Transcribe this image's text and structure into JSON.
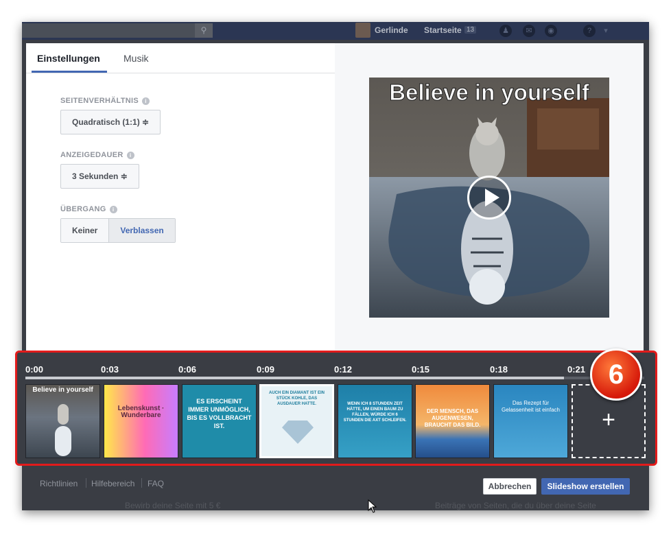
{
  "topbar": {
    "user_name": "Gerlinde",
    "home_label": "Startseite",
    "home_count": "13"
  },
  "background": {
    "snippet_left": "Bewirb deine Seite mit 5 €",
    "snippet_right": "Beiträge von Seiten, die du über deine Seite"
  },
  "tabs": [
    {
      "label": "Einstellungen",
      "active": true
    },
    {
      "label": "Musik",
      "active": false
    }
  ],
  "settings": {
    "aspect": {
      "label": "SEITENVERHÄLTNIS",
      "value": "Quadratisch (1:1) ≑"
    },
    "duration": {
      "label": "ANZEIGEDAUER",
      "value": "3 Sekunden ≑"
    },
    "transition": {
      "label": "ÜBERGANG",
      "options": [
        "Keiner",
        "Verblassen"
      ],
      "selected": "Verblassen"
    }
  },
  "preview": {
    "title": "Believe in yourself",
    "play_icon": "play-icon"
  },
  "timeline": {
    "ticks": [
      "0:00",
      "0:03",
      "0:06",
      "0:09",
      "0:12",
      "0:15",
      "0:18",
      "0:21"
    ],
    "progress_fraction": 0.87,
    "thumbnails": [
      {
        "text": "Believe in yourself"
      },
      {
        "text": "Lebenskunst · Wunderbare"
      },
      {
        "text": "ES ERSCHEINT IMMER UNMÖGLICH, BIS ES VOLLBRACHT IST."
      },
      {
        "text": "AUCH EIN DIAMANT IST EIN STÜCK KOHLE, DAS AUSDAUER HATTE."
      },
      {
        "text": "WENN ICH 8 STUNDEN ZEIT HÄTTE, UM EINEN BAUM ZU FÄLLEN, WÜRDE ICH 6 STUNDEN DIE AXT SCHLEIFEN."
      },
      {
        "text": "DER MENSCH, DAS AUGENWESEN, BRAUCHT DAS BILD."
      },
      {
        "text": "Das Rezept für Gelassenheit ist einfach"
      }
    ],
    "add_label": "+",
    "step_badge": "6"
  },
  "footer": {
    "links": [
      "Richtlinien",
      "Hilfebereich",
      "FAQ"
    ],
    "cancel_label": "Abbrechen",
    "create_label": "Slideshow erstellen"
  },
  "colors": {
    "accent": "#4267b2",
    "highlight_border": "#e21b1b"
  }
}
